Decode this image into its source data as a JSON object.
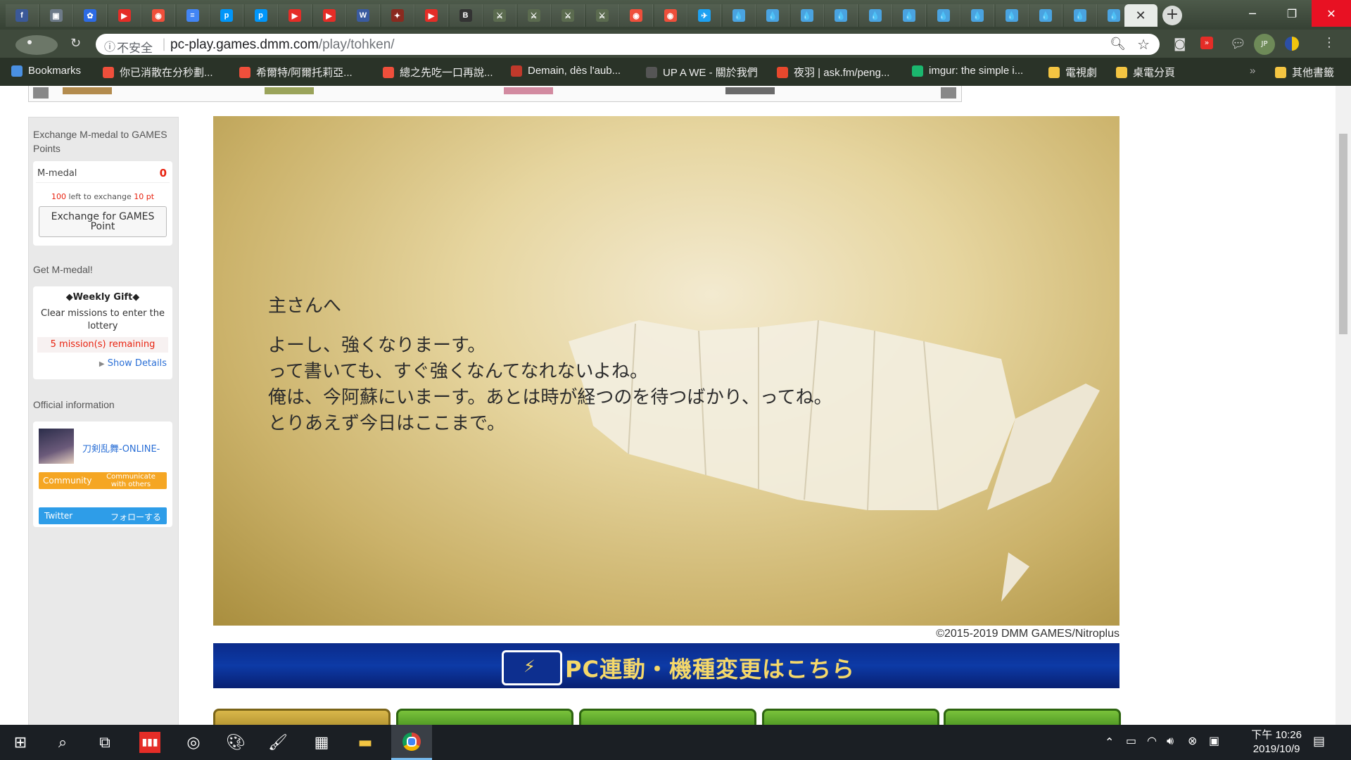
{
  "browser": {
    "tabs": [
      {
        "icon": "facebook-icon",
        "glyph": "f",
        "color": "#3b5998"
      },
      {
        "icon": "image-tab-icon",
        "glyph": "▣",
        "color": "#6d7a88"
      },
      {
        "icon": "baidu-icon",
        "glyph": "✿",
        "color": "#2d6be4"
      },
      {
        "icon": "youtube-icon",
        "glyph": "▶",
        "color": "#e52d27"
      },
      {
        "icon": "plurk-icon",
        "glyph": "◉",
        "color": "#ef4f3b"
      },
      {
        "icon": "docs-icon",
        "glyph": "≡",
        "color": "#4285f4"
      },
      {
        "icon": "pixiv-icon",
        "glyph": "p",
        "color": "#0096fa"
      },
      {
        "icon": "pixiv-icon",
        "glyph": "p",
        "color": "#0096fa"
      },
      {
        "icon": "youtube-icon",
        "glyph": "▶",
        "color": "#e52d27"
      },
      {
        "icon": "youtube-icon",
        "glyph": "▶",
        "color": "#e52d27"
      },
      {
        "icon": "wiki-icon",
        "glyph": "W",
        "color": "#3a5ba0"
      },
      {
        "icon": "game-tab-icon",
        "glyph": "✦",
        "color": "#8a2a1f"
      },
      {
        "icon": "youtube-icon",
        "glyph": "▶",
        "color": "#e52d27"
      },
      {
        "icon": "bbc-icon",
        "glyph": "B",
        "color": "#333333"
      },
      {
        "icon": "sword-tab-icon",
        "glyph": "⚔",
        "color": "#5b6b4f"
      },
      {
        "icon": "sword-tab-icon",
        "glyph": "⚔",
        "color": "#5b6b4f"
      },
      {
        "icon": "sword-tab-icon",
        "glyph": "⚔",
        "color": "#5b6b4f"
      },
      {
        "icon": "sword-tab-icon",
        "glyph": "⚔",
        "color": "#5b6b4f"
      },
      {
        "icon": "plurk-icon",
        "glyph": "◉",
        "color": "#ef4f3b"
      },
      {
        "icon": "plurk-icon",
        "glyph": "◉",
        "color": "#ef4f3b"
      },
      {
        "icon": "twitter-icon",
        "glyph": "✈",
        "color": "#1da1f2"
      },
      {
        "icon": "drop-icon",
        "glyph": "💧",
        "color": "#4aa3e0"
      },
      {
        "icon": "drop-icon",
        "glyph": "💧",
        "color": "#4aa3e0"
      },
      {
        "icon": "drop-icon",
        "glyph": "💧",
        "color": "#4aa3e0"
      },
      {
        "icon": "drop-icon",
        "glyph": "💧",
        "color": "#4aa3e0"
      },
      {
        "icon": "drop-icon",
        "glyph": "💧",
        "color": "#4aa3e0"
      },
      {
        "icon": "drop-icon",
        "glyph": "💧",
        "color": "#4aa3e0"
      },
      {
        "icon": "drop-icon",
        "glyph": "💧",
        "color": "#4aa3e0"
      },
      {
        "icon": "drop-icon",
        "glyph": "💧",
        "color": "#4aa3e0"
      },
      {
        "icon": "drop-icon",
        "glyph": "💧",
        "color": "#4aa3e0"
      },
      {
        "icon": "drop-icon",
        "glyph": "💧",
        "color": "#4aa3e0"
      },
      {
        "icon": "drop-icon",
        "glyph": "💧",
        "color": "#4aa3e0"
      },
      {
        "icon": "drop-icon",
        "glyph": "💧",
        "color": "#4aa3e0"
      }
    ],
    "address": {
      "security_label": "不安全",
      "host": "pc-play.games.dmm.com",
      "path": "/play/tohken/"
    },
    "bookmarks": [
      {
        "label": "Bookmarks",
        "icon": "star-icon",
        "color": "#4a90e2"
      },
      {
        "label": "你已消散在分秒劃...",
        "icon": "plurk-icon",
        "color": "#ef4f3b"
      },
      {
        "label": "希爾特/阿爾托莉亞...",
        "icon": "plurk-icon",
        "color": "#ef4f3b"
      },
      {
        "label": "總之先吃一口再說...",
        "icon": "plurk-icon",
        "color": "#ef4f3b"
      },
      {
        "label": "Demain, dès l'aub...",
        "icon": "bookmark-icon",
        "color": "#c0392b"
      },
      {
        "label": "UP A WE - 關於我們",
        "icon": "upawe-icon",
        "color": "#555555"
      },
      {
        "label": "夜羽 | ask.fm/peng...",
        "icon": "askfm-icon",
        "color": "#e8482d"
      },
      {
        "label": "imgur: the simple i...",
        "icon": "imgur-icon",
        "color": "#1bb76e"
      },
      {
        "label": "電視劇",
        "icon": "folder-icon",
        "color": "#f4c542"
      },
      {
        "label": "桌電分頁",
        "icon": "folder-icon",
        "color": "#f4c542"
      }
    ],
    "other_bookmarks": "其他書籤"
  },
  "sidebar": {
    "exchange_title": "Exchange M-medal to GAMES Points",
    "mmedal_label": "M-medal",
    "mmedal_value": "0",
    "left_count": "100",
    "left_text": "left to exchange",
    "left_pt": "10 pt",
    "exchange_button": "Exchange for GAMES Point",
    "get_title": "Get M-medal!",
    "weekly_title": "◆Weekly Gift◆",
    "weekly_desc": "Clear missions to enter the lottery",
    "missions_remaining": "5 mission(s) remaining",
    "show_details": "Show Details",
    "official_title": "Official information",
    "game_name": "刀剣乱舞-ONLINE-",
    "community_label": "Community",
    "community_sub": "Communicate with others",
    "twitter_label": "Twitter",
    "twitter_follow": "フォローする"
  },
  "game": {
    "letter_greeting": "主さんへ",
    "letter_lines": [
      "よーし、強くなりまーす。",
      "って書いても、すぐ強くなんてなれないよね。",
      "俺は、今阿蘇にいまーす。あとは時が経つのを待つばかり、ってね。",
      "とりあえず今日はここまで。"
    ],
    "copyright": "©2015-2019 DMM GAMES/Nitroplus",
    "pc_banner": "PC連動・機種変更はこちら"
  },
  "taskbar": {
    "time": "下午 10:26",
    "date": "2019/10/9"
  },
  "colors": {
    "accent_red": "#e8220f",
    "community_orange": "#f5a623",
    "twitter_blue": "#1da1f2"
  }
}
